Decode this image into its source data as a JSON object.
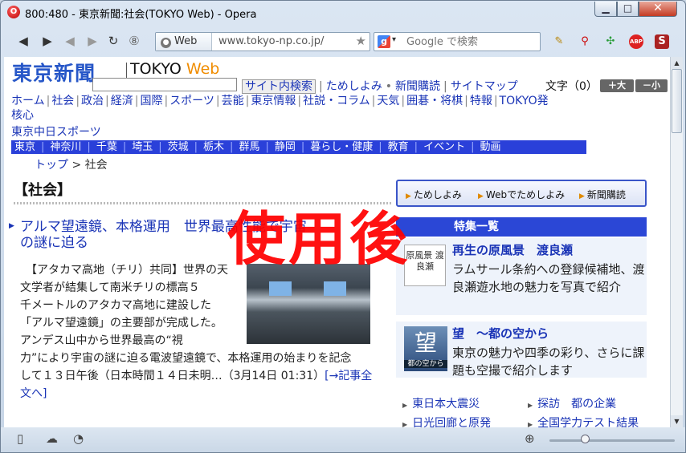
{
  "window": {
    "title": "800:480 - 東京新聞:社会(TOKYO Web) - Opera",
    "app_logo": "O",
    "min_label": "▁",
    "max_label": "□",
    "close_label": "✕"
  },
  "toolbar": {
    "back": "◀",
    "forward": "▶",
    "rewind": "◀",
    "fast_forward": "▶",
    "reload": "↻",
    "speed_dial": "⑧",
    "site_label": "Web",
    "url": "www.tokyo-np.co.jp/",
    "search_engine_icon": "g",
    "search_placeholder": "Google で検索",
    "tools": [
      "notes-icon",
      "find-icon",
      "turbo-icon",
      "adblock-icon",
      "extension-icon"
    ]
  },
  "page": {
    "logo_kanji": "東京新聞",
    "logo_tokyo": "TOKYO ",
    "logo_web": "Web",
    "utility_links": [
      "サイト内検索",
      "ためしよみ",
      "新聞購読",
      "サイトマップ"
    ],
    "font_size_label": "文字（0）",
    "font_big": "＋大",
    "font_small": "－小",
    "global_nav": [
      "ホーム",
      "社会",
      "政治",
      "経済",
      "国際",
      "スポーツ",
      "芸能",
      "東京情報",
      "社説・コラム",
      "天気",
      "囲碁・将棋",
      "特報",
      "TOKYO発",
      "核心"
    ],
    "subsite": "東京中日スポーツ",
    "regional_nav": [
      "東京",
      "神奈川",
      "千葉",
      "埼玉",
      "茨城",
      "栃木",
      "群馬",
      "静岡",
      "暮らし・健康",
      "教育",
      "イベント",
      "動画"
    ],
    "breadcrumb_home": "トップ",
    "breadcrumb_sep": " > ",
    "breadcrumb_current": "社会",
    "section_title": "【社会】",
    "headline_line1": "アルマ望遠鏡、本格運用　世界最高性能で宇宙",
    "headline_line2": "の謎に迫る",
    "body_lines": [
      "　【アタカマ高地（チリ）共同】世界の天",
      "文学者が結集して南米チリの標高５",
      "千メートルのアタカマ高地に建設した",
      "「アルマ望遠鏡」の主要部が完成した。",
      "アンデス山中から世界最高の“視"
    ],
    "body_wide1": "力”により宇宙の謎に迫る電波望遠鏡で、本格運用の始まりを記念",
    "body_wide2": "して１３日午後（日本時間１４日未明…（3月14日 01:31）",
    "read_more": "[→記事全文へ]",
    "sidebar_tabs": [
      "ためしよみ",
      "Webでためしよみ",
      "新聞購読"
    ],
    "feature_bar": "特集一覧",
    "feature1_title": "再生の原風景　渡良瀬",
    "feature1_desc": "ラムサール条約への登録候補地、渡良瀬遊水地の魅力を写真で紹介",
    "feature1_thumb": "原風景 渡良瀬",
    "feature2_title": "望　～都の空から",
    "feature2_desc": "東京の魅力や四季の彩り、さらに課題も空撮で紹介します",
    "feature2_thumb_big": "望",
    "feature2_thumb_small": "都の空から",
    "sidebar_links": [
      "東日本大震災",
      "探訪　都の企業",
      "日光回廊と原発",
      "全国学力テスト結果"
    ]
  },
  "overlay_stamp": "使用後",
  "colors": {
    "link": "#1a34b6",
    "nav_blue": "#2a40d9",
    "stamp": "#ff0000",
    "logo_orange": "#f08c00"
  }
}
